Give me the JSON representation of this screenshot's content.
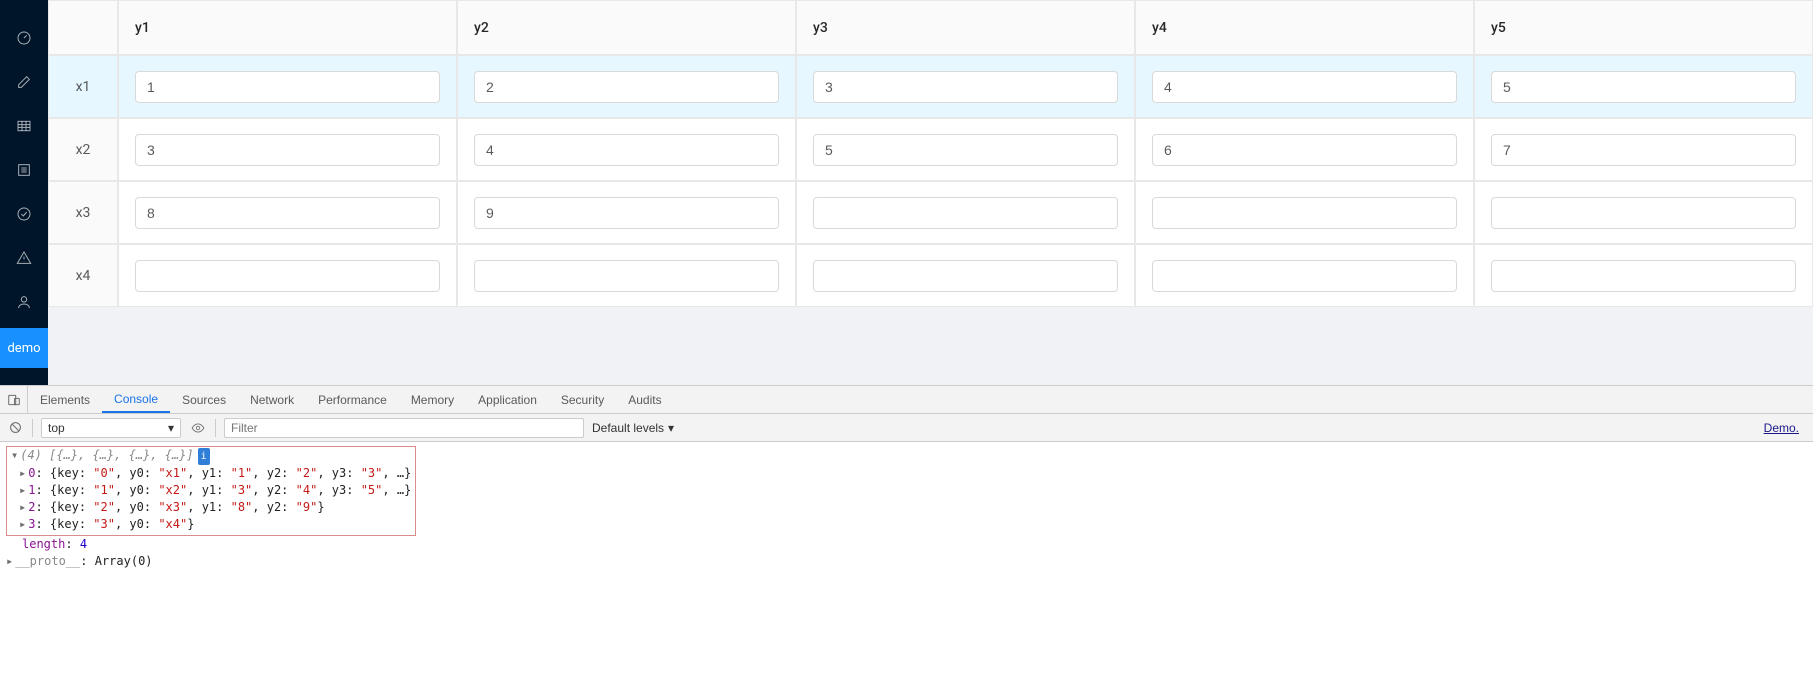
{
  "sidebar": {
    "icons": [
      "dashboard-icon",
      "edit-icon",
      "table-icon",
      "list-icon",
      "check-circle-icon",
      "warning-icon",
      "user-icon"
    ],
    "demo_label": "demo"
  },
  "grid": {
    "columns": [
      "y1",
      "y2",
      "y3",
      "y4",
      "y5"
    ],
    "rows": [
      {
        "name": "x1",
        "highlight": true,
        "cells": [
          "1",
          "2",
          "3",
          "4",
          "5"
        ]
      },
      {
        "name": "x2",
        "highlight": false,
        "cells": [
          "3",
          "4",
          "5",
          "6",
          "7"
        ]
      },
      {
        "name": "x3",
        "highlight": false,
        "cells": [
          "8",
          "9",
          "",
          "",
          ""
        ]
      },
      {
        "name": "x4",
        "highlight": false,
        "cells": [
          "",
          "",
          "",
          "",
          ""
        ]
      }
    ]
  },
  "devtools": {
    "tabs": [
      "Elements",
      "Console",
      "Sources",
      "Network",
      "Performance",
      "Memory",
      "Application",
      "Security",
      "Audits"
    ],
    "active_tab": "Console",
    "context": "top",
    "filter_placeholder": "Filter",
    "levels_label": "Default levels",
    "source_link": "Demo.",
    "console": {
      "header": "(4) [{…}, {…}, {…}, {…}]",
      "info_badge": "i",
      "rows": [
        {
          "idx": "0",
          "pairs": [
            [
              "key",
              "\"0\""
            ],
            [
              "y0",
              "\"x1\""
            ],
            [
              "y1",
              "\"1\""
            ],
            [
              "y2",
              "\"2\""
            ],
            [
              "y3",
              "\"3\""
            ]
          ],
          "more": true
        },
        {
          "idx": "1",
          "pairs": [
            [
              "key",
              "\"1\""
            ],
            [
              "y0",
              "\"x2\""
            ],
            [
              "y1",
              "\"3\""
            ],
            [
              "y2",
              "\"4\""
            ],
            [
              "y3",
              "\"5\""
            ]
          ],
          "more": true
        },
        {
          "idx": "2",
          "pairs": [
            [
              "key",
              "\"2\""
            ],
            [
              "y0",
              "\"x3\""
            ],
            [
              "y1",
              "\"8\""
            ],
            [
              "y2",
              "\"9\""
            ]
          ],
          "more": false
        },
        {
          "idx": "3",
          "pairs": [
            [
              "key",
              "\"3\""
            ],
            [
              "y0",
              "\"x4\""
            ]
          ],
          "more": false
        }
      ],
      "length_label": "length",
      "length_value": "4",
      "proto_label": "__proto__",
      "proto_value": "Array(0)"
    }
  }
}
